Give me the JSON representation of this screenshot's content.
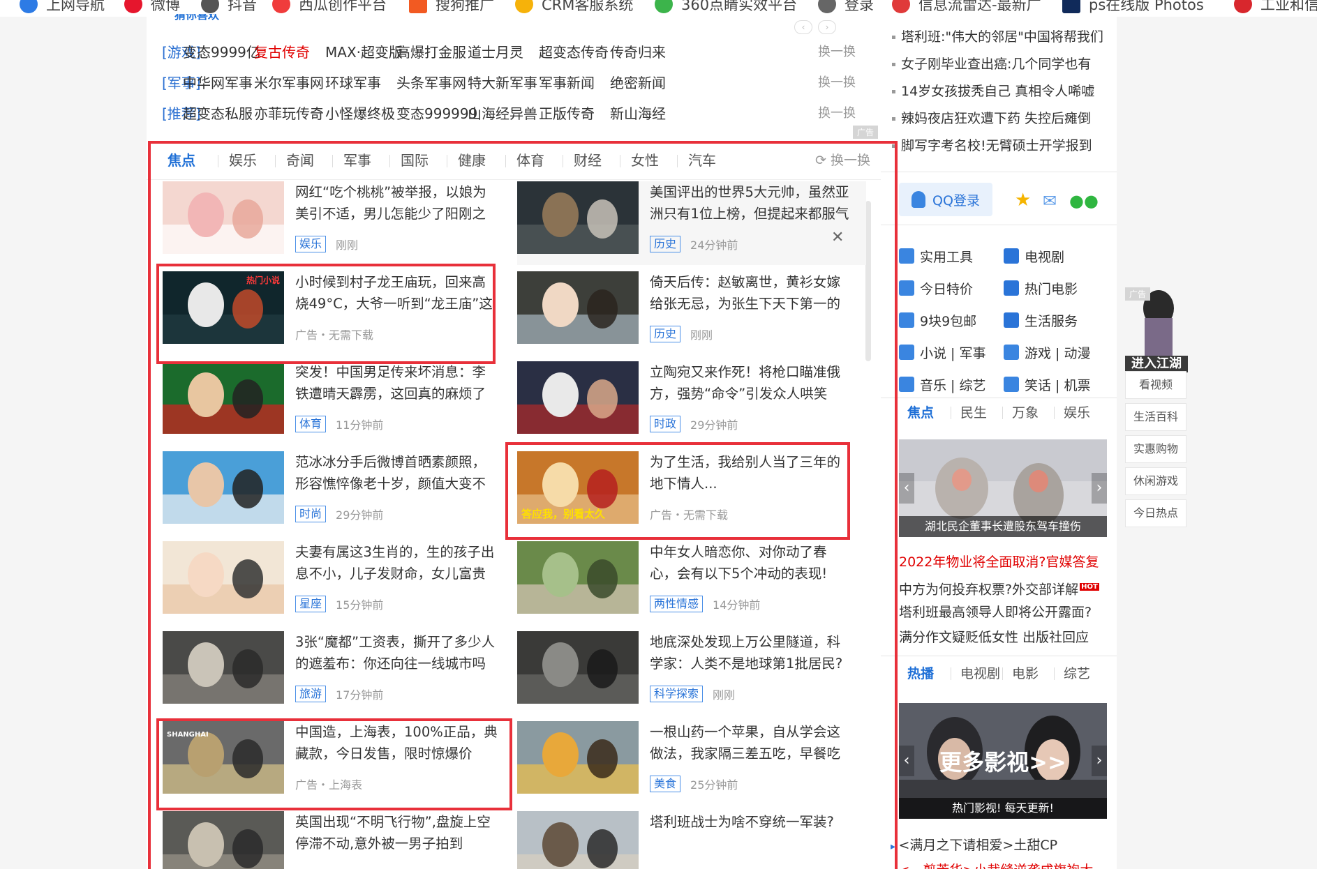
{
  "bookmarks": [
    "上网导航",
    "微博",
    "抖音",
    "西瓜创作平台",
    "搜狗推广",
    "CRM客服系统",
    "360点睛实效平台",
    "登录",
    "信息流雷达-最新广",
    "ps在线版 Photos",
    "工业和信"
  ],
  "top_links": {
    "header": "猜你喜欢",
    "ad_label": "广告",
    "swap_label": "换一换",
    "rows": [
      {
        "category": "[游戏]",
        "links": [
          "变态9999亿",
          "复古传奇",
          "MAX·超变版",
          "高爆打金服",
          "道士月灵",
          "超变态传奇",
          "传奇归来"
        ],
        "red_index": 1
      },
      {
        "category": "[军事]",
        "links": [
          "中华网军事",
          "米尔军事网",
          "环球军事",
          "头条军事网",
          "特大新军事",
          "军事新闻",
          "绝密新闻"
        ],
        "red_index": -1
      },
      {
        "category": "[推荐]",
        "links": [
          "超变态私服",
          "亦菲玩传奇",
          "小怪爆终极",
          "变态999999",
          "山海经异兽",
          "正版传奇",
          "新山海经"
        ],
        "red_index": -1
      }
    ]
  },
  "news": {
    "tabs": [
      "焦点",
      "娱乐",
      "奇闻",
      "军事",
      "国际",
      "健康",
      "体育",
      "财经",
      "女性",
      "汽车"
    ],
    "active_tab": 0,
    "swap_label": "换一换",
    "cards": [
      {
        "title": "网红“吃个桃桃”被举报，以娘为美引不适，男儿怎能少了阳刚之",
        "tag": "娱乐",
        "time": "刚刚",
        "is_ad": false
      },
      {
        "title": "美国评出的世界5大元帅，虽然亚洲只有1位上榜，但提起来都服气",
        "tag": "历史",
        "time": "24分钟前",
        "is_ad": false
      },
      {
        "title": "小时候到村子龙王庙玩，回来高烧49°C，大爷一听到“龙王庙”这",
        "tag": "",
        "time": "广告・无需下载",
        "is_ad": true
      },
      {
        "title": "倚天后传：赵敏离世，黄衫女嫁给张无忌，为张生下天下第一的",
        "tag": "历史",
        "time": "刚刚",
        "is_ad": false
      },
      {
        "title": "突发！中国男足传来坏消息：李铁遭晴天霹雳，这回真的麻烦了",
        "tag": "体育",
        "time": "11分钟前",
        "is_ad": false
      },
      {
        "title": "立陶宛又来作死！将枪口瞄准俄方，强势“命令”引发众人哄笑",
        "tag": "时政",
        "time": "29分钟前",
        "is_ad": false
      },
      {
        "title": "范冰冰分手后微博首晒素颜照，形容憔悴像老十岁，颜值大变不",
        "tag": "时尚",
        "time": "29分钟前",
        "is_ad": false
      },
      {
        "title": "为了生活，我给别人当了三年的地下情人...",
        "tag": "",
        "time": "广告・无需下载",
        "is_ad": true
      },
      {
        "title": "夫妻有属这3生肖的，生的孩子出息不小，儿子发财命，女儿富贵",
        "tag": "星座",
        "time": "15分钟前",
        "is_ad": false
      },
      {
        "title": "中年女人暗恋你、对你动了春心，会有以下5个冲动的表现!",
        "tag": "两性情感",
        "time": "14分钟前",
        "is_ad": false
      },
      {
        "title": "3张“魔都”工资表，撕开了多少人的遮羞布：你还向往一线城市吗",
        "tag": "旅游",
        "time": "17分钟前",
        "is_ad": false
      },
      {
        "title": "地底深处发现上万公里隧道，科学家：人类不是地球第1批居民?",
        "tag": "科学探索",
        "time": "刚刚",
        "is_ad": false
      },
      {
        "title": "中国造，上海表，100%正品，典藏款，今日发售，限时惊爆价",
        "tag": "",
        "time": "广告・上海表",
        "is_ad": true
      },
      {
        "title": "一根山药一个苹果，自从学会这做法，我家隔三差五吃，早餐吃",
        "tag": "美食",
        "time": "25分钟前",
        "is_ad": false
      },
      {
        "title": "英国出现“不明飞行物”,盘旋上空停滞不动,意外被一男子拍到",
        "tag": "",
        "time": "",
        "is_ad": false
      },
      {
        "title": "塔利班战士为啥不穿统一军装?",
        "tag": "",
        "time": "",
        "is_ad": false
      }
    ],
    "thumb_captions": {
      "c2": "热门小说",
      "c7": "答应我，别看太久",
      "c12": "SHANGHAI"
    }
  },
  "sidebar": {
    "top_news": [
      "塔利班:\"伟大的邻居\"中国将帮我们",
      "女子刚毕业查出癌:几个同学也有",
      "14岁女孩拔秃自己 真相令人唏嘘",
      "辣妈夜店狂欢遭下药 失控后瘫倒",
      "脚写字考名校!无臂硕士开学报到"
    ],
    "qq_login": "QQ登录",
    "tools": [
      "实用工具",
      "电视剧",
      "今日特价",
      "热门电影",
      "9块9包邮",
      "生活服务",
      "小说 | 军事",
      "游戏 | 动漫",
      "音乐 | 综艺",
      "笑话 | 机票"
    ],
    "tabs1": [
      "焦点",
      "民生",
      "万象",
      "娱乐"
    ],
    "banner1_caption": "湖北民企董事长遭股东驾车撞伤",
    "hot_news": [
      {
        "text": "2022年物业将全面取消?官媒答复",
        "red": true,
        "hot": false
      },
      {
        "text": "中方为何投弃权票?外交部详解",
        "red": false,
        "hot": true
      },
      {
        "text": "塔利班最高领导人即将公开露面?",
        "red": false,
        "hot": false
      },
      {
        "text": "满分作文疑贬低女性 出版社回应",
        "red": false,
        "hot": false
      }
    ],
    "hot_badge": "HOT",
    "tabs2": [
      "热播",
      "电视剧",
      "电影",
      "综艺"
    ],
    "banner2_title": "更多影视>>",
    "banner2_caption": "热门影视! 每天更新!",
    "video_link": "<满月之下请相爱>土甜CP",
    "video_link2": "<一剪芳华>小裁缝逆袭成旗袍大"
  },
  "float_widget": {
    "ad_label": "广告",
    "banner": "进入江湖",
    "buttons": [
      "看视频",
      "生活百科",
      "实惠购物",
      "休闲游戏",
      "今日热点"
    ]
  },
  "colors": {
    "accent": "#1e6fd6",
    "link_red": "#e00000",
    "annotation": "#e8303a"
  }
}
